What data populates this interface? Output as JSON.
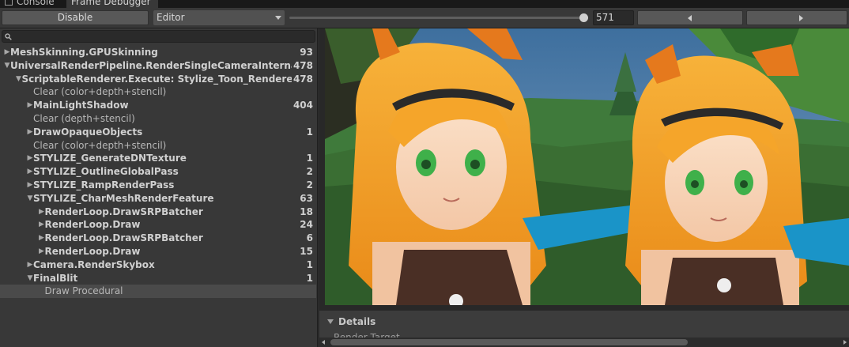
{
  "tabs": [
    {
      "label": "Console",
      "icon": "console-icon"
    },
    {
      "label": "Frame Debugger",
      "active": true
    }
  ],
  "toolbar": {
    "disable_label": "Disable",
    "target_dropdown": "Editor",
    "event_index": "571",
    "event_slider_level": 1.0
  },
  "search": {
    "placeholder": "",
    "icon": "search-icon"
  },
  "tree": [
    {
      "label": "MeshSkinning.GPUSkinning",
      "count": "93",
      "depth": 0,
      "arrow": "collapsed",
      "bold": true
    },
    {
      "label": "UniversalRenderPipeline.RenderSingleCameraInternal: Ca",
      "count": "478",
      "depth": 0,
      "arrow": "expanded",
      "bold": true
    },
    {
      "label": "ScriptableRenderer.Execute: Stylize_Toon_Renderer",
      "count": "478",
      "depth": 1,
      "arrow": "expanded",
      "bold": true
    },
    {
      "label": "Clear (color+depth+stencil)",
      "count": "",
      "depth": 2,
      "arrow": "none",
      "bold": false
    },
    {
      "label": "MainLightShadow",
      "count": "404",
      "depth": 2,
      "arrow": "collapsed",
      "bold": true
    },
    {
      "label": "Clear (depth+stencil)",
      "count": "",
      "depth": 2,
      "arrow": "none",
      "bold": false
    },
    {
      "label": "DrawOpaqueObjects",
      "count": "1",
      "depth": 2,
      "arrow": "collapsed",
      "bold": true
    },
    {
      "label": "Clear (color+depth+stencil)",
      "count": "",
      "depth": 2,
      "arrow": "none",
      "bold": false
    },
    {
      "label": "STYLIZE_GenerateDNTexture",
      "count": "1",
      "depth": 2,
      "arrow": "collapsed",
      "bold": true
    },
    {
      "label": "STYLIZE_OutlineGlobalPass",
      "count": "2",
      "depth": 2,
      "arrow": "collapsed",
      "bold": true
    },
    {
      "label": "STYLIZE_RampRenderPass",
      "count": "2",
      "depth": 2,
      "arrow": "collapsed",
      "bold": true
    },
    {
      "label": "STYLIZE_CharMeshRenderFeature",
      "count": "63",
      "depth": 2,
      "arrow": "expanded",
      "bold": true
    },
    {
      "label": "RenderLoop.DrawSRPBatcher",
      "count": "18",
      "depth": 3,
      "arrow": "collapsed",
      "bold": true
    },
    {
      "label": "RenderLoop.Draw",
      "count": "24",
      "depth": 3,
      "arrow": "collapsed",
      "bold": true
    },
    {
      "label": "RenderLoop.DrawSRPBatcher",
      "count": "6",
      "depth": 3,
      "arrow": "collapsed",
      "bold": true
    },
    {
      "label": "RenderLoop.Draw",
      "count": "15",
      "depth": 3,
      "arrow": "collapsed",
      "bold": true
    },
    {
      "label": "Camera.RenderSkybox",
      "count": "1",
      "depth": 2,
      "arrow": "collapsed",
      "bold": true
    },
    {
      "label": "FinalBlit",
      "count": "1",
      "depth": 2,
      "arrow": "expanded",
      "bold": true
    },
    {
      "label": "Draw Procedural",
      "count": "",
      "depth": 3,
      "arrow": "none",
      "bold": false,
      "selected": true
    }
  ],
  "details": {
    "header": "Details",
    "cut_line": "Render Target"
  }
}
